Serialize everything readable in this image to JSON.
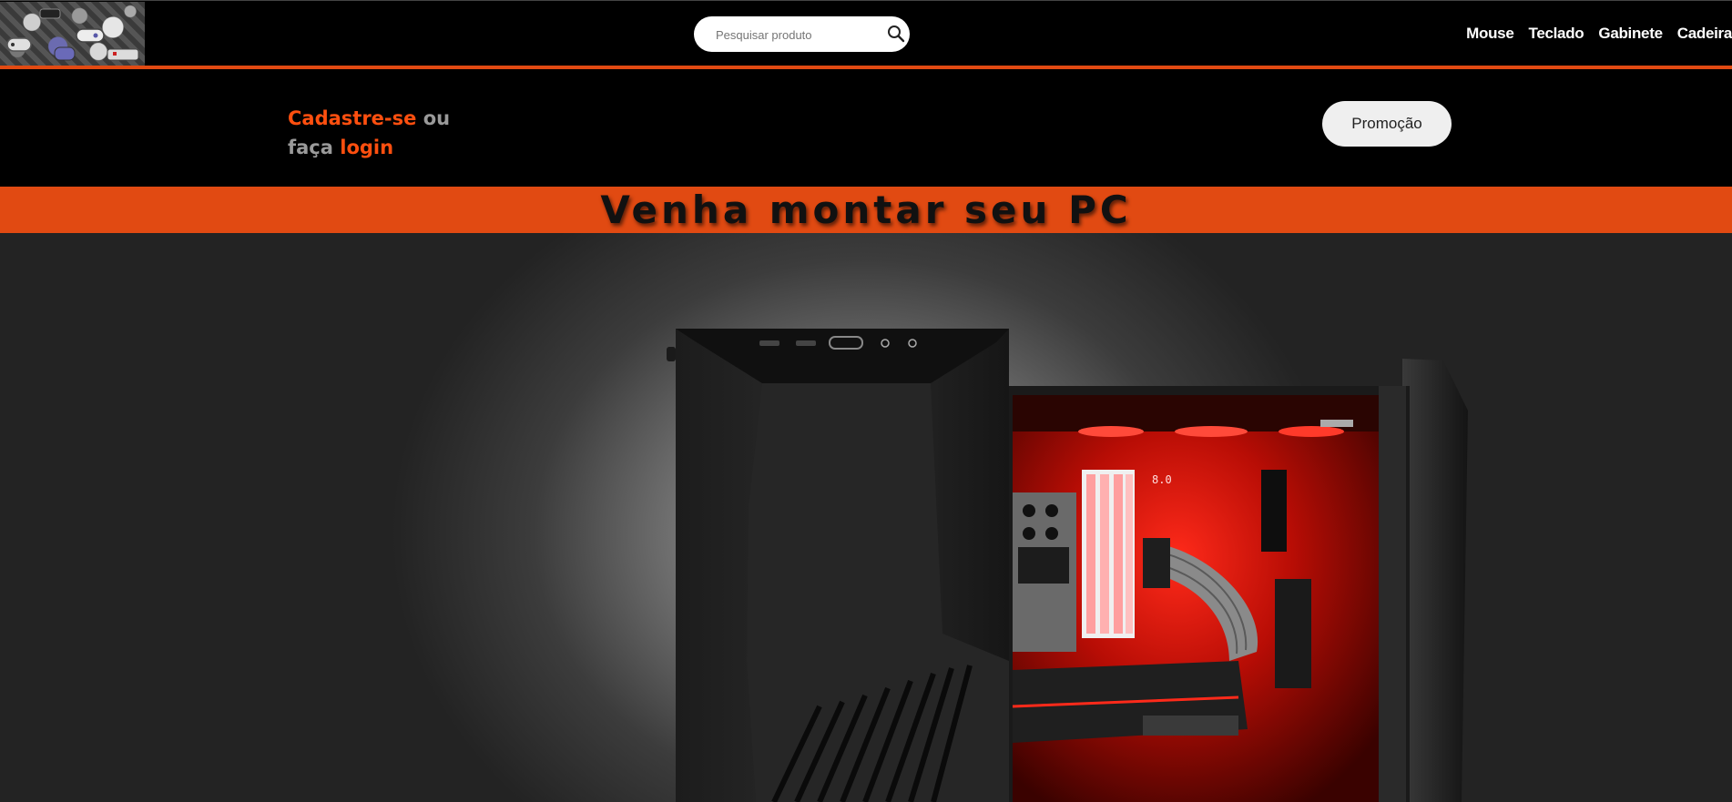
{
  "header": {
    "logo_name": "gaming-controllers-logo",
    "search": {
      "placeholder": "Pesquisar produto",
      "icon": "search-icon"
    },
    "nav": [
      {
        "label": "Mouse"
      },
      {
        "label": "Teclado"
      },
      {
        "label": "Gabinete"
      },
      {
        "label": "Cadeira"
      }
    ]
  },
  "account": {
    "signup_link": "Cadastre-se",
    "or_text": " ou",
    "do_text": "faça ",
    "login_link": "login",
    "promo_button": "Promoção"
  },
  "banner": {
    "title": "Venha montar seu PC"
  },
  "hero": {
    "image": "pc-gaming-case-image"
  },
  "colors": {
    "accent": "#e14a12",
    "link": "#ff4f0f",
    "background": "#000000"
  }
}
